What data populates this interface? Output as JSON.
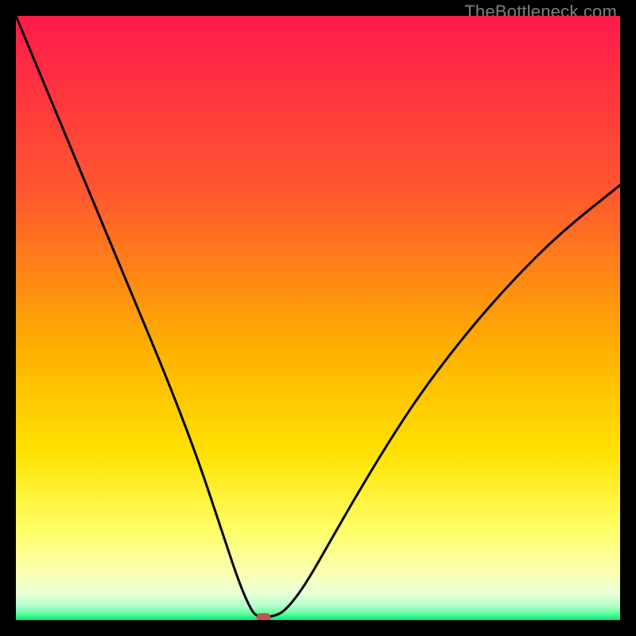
{
  "watermark": "TheBottleneck.com",
  "chart_data": {
    "type": "line",
    "title": "",
    "xlabel": "",
    "ylabel": "",
    "xlim": [
      0,
      100
    ],
    "ylim": [
      0,
      100
    ],
    "minimum_x": 41,
    "marker": {
      "x": 41,
      "y": 0.5
    },
    "gradient_stops": [
      {
        "offset": 0,
        "color": "#ff1a4b"
      },
      {
        "offset": 0.3,
        "color": "#ff5a2d"
      },
      {
        "offset": 0.55,
        "color": "#ffb000"
      },
      {
        "offset": 0.72,
        "color": "#ffe100"
      },
      {
        "offset": 0.85,
        "color": "#ffff66"
      },
      {
        "offset": 0.92,
        "color": "#fbffb0"
      },
      {
        "offset": 0.955,
        "color": "#eaffd6"
      },
      {
        "offset": 0.975,
        "color": "#b8ffcf"
      },
      {
        "offset": 0.99,
        "color": "#5cff9e"
      },
      {
        "offset": 1.0,
        "color": "#00e57a"
      }
    ],
    "curve_left": [
      {
        "x": 0,
        "y": 100
      },
      {
        "x": 5,
        "y": 88
      },
      {
        "x": 10,
        "y": 76
      },
      {
        "x": 15,
        "y": 64
      },
      {
        "x": 20,
        "y": 52
      },
      {
        "x": 25,
        "y": 40
      },
      {
        "x": 30,
        "y": 27
      },
      {
        "x": 34,
        "y": 15
      },
      {
        "x": 37,
        "y": 6
      },
      {
        "x": 39,
        "y": 1.5
      },
      {
        "x": 40,
        "y": 0.6
      },
      {
        "x": 41,
        "y": 0.5
      }
    ],
    "curve_right": [
      {
        "x": 41,
        "y": 0.5
      },
      {
        "x": 43,
        "y": 0.6
      },
      {
        "x": 45,
        "y": 2
      },
      {
        "x": 48,
        "y": 6
      },
      {
        "x": 52,
        "y": 13
      },
      {
        "x": 56,
        "y": 20
      },
      {
        "x": 62,
        "y": 30
      },
      {
        "x": 68,
        "y": 39
      },
      {
        "x": 75,
        "y": 48
      },
      {
        "x": 82,
        "y": 56
      },
      {
        "x": 90,
        "y": 64
      },
      {
        "x": 100,
        "y": 72
      }
    ],
    "marker_color": "#c1524f"
  }
}
